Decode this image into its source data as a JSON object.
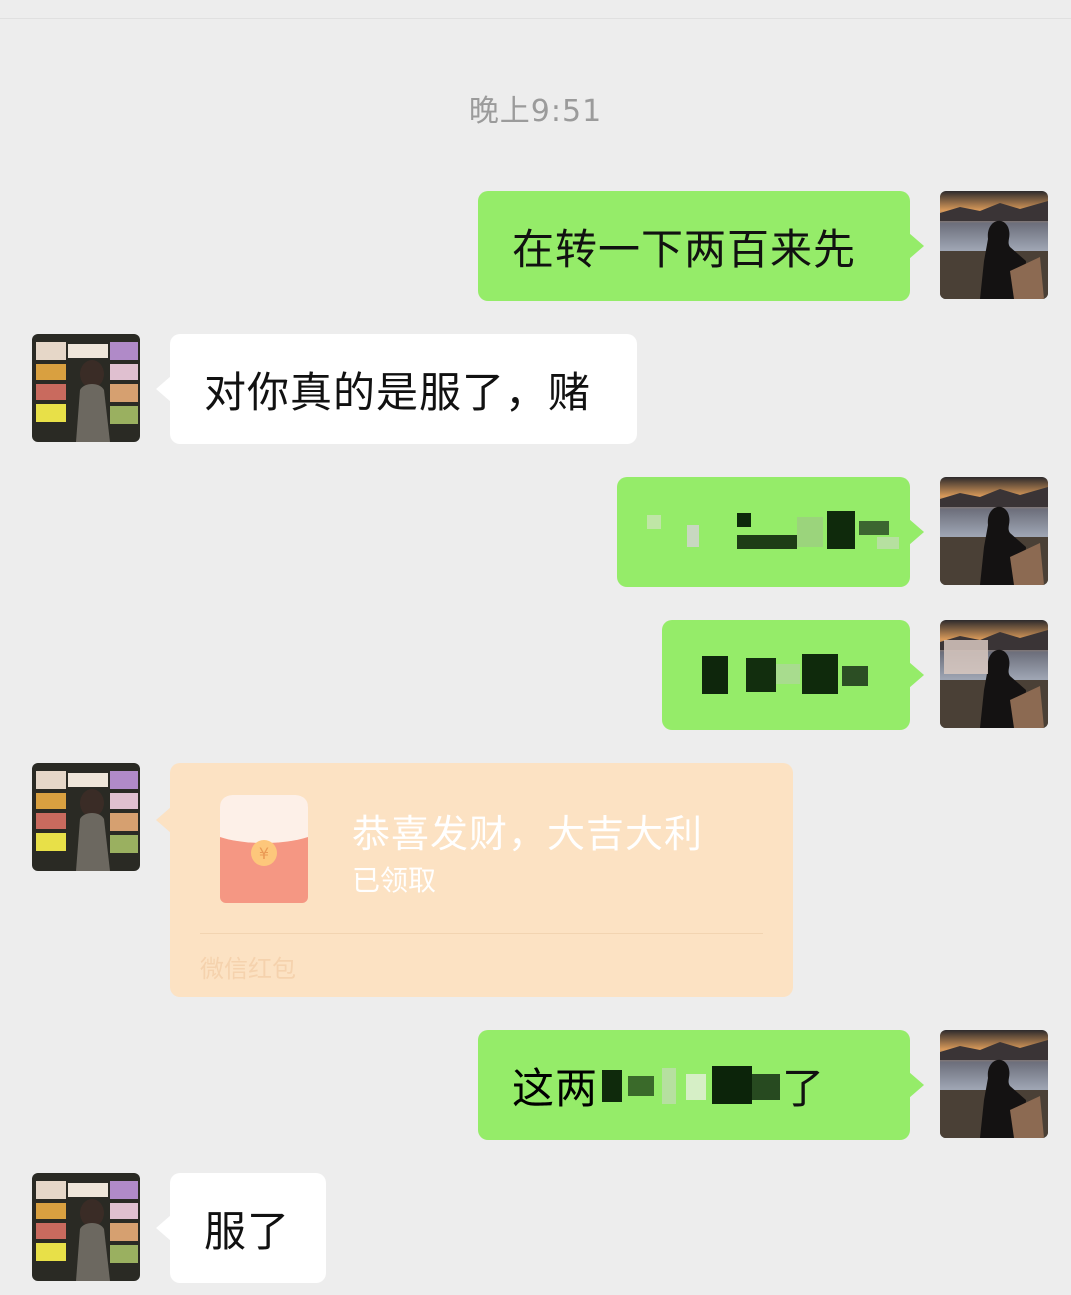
{
  "timestamp": "晚上9:51",
  "messages": {
    "m1": {
      "text": "在转一下两百来先",
      "side": "outgoing"
    },
    "m2": {
      "text": "对你真的是服了，赌",
      "side": "incoming"
    },
    "m3": {
      "text": "",
      "side": "outgoing",
      "redacted": true
    },
    "m4": {
      "text": "",
      "side": "outgoing",
      "redacted": true
    },
    "m5": {
      "title": "恭喜发财，大吉大利",
      "status": "已领取",
      "footer": "微信红包",
      "type": "red-packet",
      "side": "incoming"
    },
    "m6": {
      "text_start": "这两",
      "text_end": "了",
      "side": "outgoing",
      "partially_redacted": true
    },
    "m7": {
      "text": "服了",
      "side": "incoming"
    }
  },
  "colors": {
    "background": "#ededed",
    "outgoing_bubble": "#95ec69",
    "incoming_bubble": "#ffffff",
    "red_packet": "#fce2c3",
    "timestamp": "#9b9b9b"
  },
  "avatars": {
    "self": "lakeside-sunset-silhouette-avatar",
    "other": "flower-shop-girl-avatar"
  }
}
